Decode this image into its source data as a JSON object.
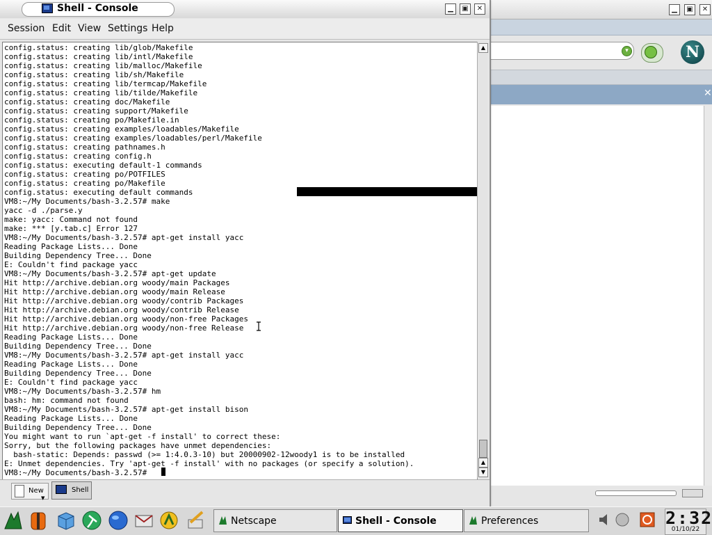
{
  "console": {
    "title": "Shell - Console",
    "menu": [
      "Session",
      "Edit",
      "View",
      "Settings",
      "Help"
    ],
    "lines": [
      "config.status: creating lib/glob/Makefile",
      "config.status: creating lib/intl/Makefile",
      "config.status: creating lib/malloc/Makefile",
      "config.status: creating lib/sh/Makefile",
      "config.status: creating lib/termcap/Makefile",
      "config.status: creating lib/tilde/Makefile",
      "config.status: creating doc/Makefile",
      "config.status: creating support/Makefile",
      "config.status: creating po/Makefile.in",
      "config.status: creating examples/loadables/Makefile",
      "config.status: creating examples/loadables/perl/Makefile",
      "config.status: creating pathnames.h",
      "config.status: creating config.h",
      "config.status: executing default-1 commands",
      "config.status: creating po/POTFILES",
      "config.status: creating po/Makefile",
      "config.status: executing default commands",
      "VM8:~/My Documents/bash-3.2.57# make",
      "yacc -d ./parse.y",
      "make: yacc: Command not found",
      "make: *** [y.tab.c] Error 127",
      "VM8:~/My Documents/bash-3.2.57# apt-get install yacc",
      "Reading Package Lists... Done",
      "Building Dependency Tree... Done",
      "E: Couldn't find package yacc",
      "VM8:~/My Documents/bash-3.2.57# apt-get update",
      "Hit http://archive.debian.org woody/main Packages",
      "Hit http://archive.debian.org woody/main Release",
      "Hit http://archive.debian.org woody/contrib Packages",
      "Hit http://archive.debian.org woody/contrib Release",
      "Hit http://archive.debian.org woody/non-free Packages",
      "Hit http://archive.debian.org woody/non-free Release",
      "Reading Package Lists... Done",
      "Building Dependency Tree... Done",
      "VM8:~/My Documents/bash-3.2.57# apt-get install yacc",
      "Reading Package Lists... Done",
      "Building Dependency Tree... Done",
      "E: Couldn't find package yacc",
      "VM8:~/My Documents/bash-3.2.57# hm",
      "bash: hm: command not found",
      "VM8:~/My Documents/bash-3.2.57# apt-get install bison",
      "Reading Package Lists... Done",
      "Building Dependency Tree... Done",
      "You might want to run `apt-get -f install' to correct these:",
      "Sorry, but the following packages have unmet dependencies:",
      "  bash-static: Depends: passwd (>= 1:4.0.3-10) but 20000902-12woody1 is to be installed",
      "E: Unmet dependencies. Try 'apt-get -f install' with no packages (or specify a solution).",
      "VM8:~/My Documents/bash-3.2.57# "
    ],
    "tabs": {
      "new_label": "New",
      "shell_label": "Shell"
    }
  },
  "netscape": {
    "logo_letter": "N"
  },
  "taskbar": {
    "tasks": [
      "Netscape",
      "Shell - Console",
      "Preferences"
    ],
    "clock": {
      "time": "2:32",
      "date": "01/10/22"
    }
  },
  "colors": {
    "terminal_bg": "#ffffff",
    "terminal_fg": "#000000",
    "sidebar_header": "#8da8c5"
  }
}
